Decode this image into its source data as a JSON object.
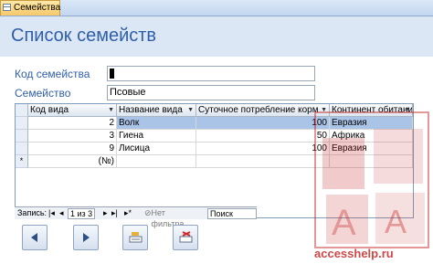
{
  "tab": {
    "label": "Семейства"
  },
  "form": {
    "title": "Список семейств"
  },
  "fields": {
    "family_code_label": "Код семейства",
    "family_code_value": "",
    "family_label": "Семейство",
    "family_value": "Псовые"
  },
  "grid": {
    "columns": [
      "Код вида",
      "Название вида",
      "Суточное потребление корм",
      "Континент обитания"
    ],
    "rows": [
      {
        "code": "2",
        "name": "Волк",
        "intake": "100",
        "continent": "Евразия"
      },
      {
        "code": "3",
        "name": "Гиена",
        "intake": "50",
        "continent": "Африка"
      },
      {
        "code": "9",
        "name": "Лисица",
        "intake": "100",
        "continent": "Евразия"
      }
    ],
    "new_row": {
      "marker": "*",
      "code": "(№)"
    }
  },
  "navigation": {
    "record_label": "Запись:",
    "record_position": "1 из 3",
    "filter_label": "Нет фильтра",
    "search_label": "Поиск"
  },
  "watermark": {
    "text": "accesshelp.ru"
  },
  "colors": {
    "header_bg": "#dbe7f5",
    "title": "#2f5ea9",
    "selection": "#a9c4e6",
    "watermark": "#c41a1a"
  }
}
